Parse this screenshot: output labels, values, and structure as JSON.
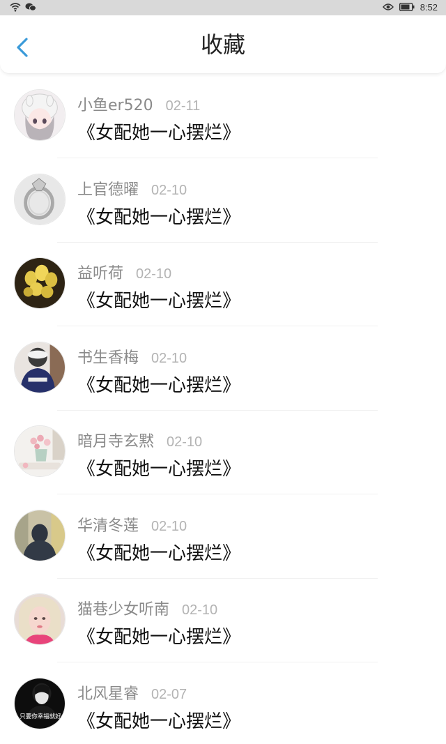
{
  "status_bar": {
    "time": "8:52",
    "icons": [
      "wifi-icon",
      "wechat-icon",
      "eye-icon",
      "battery-icon"
    ]
  },
  "header": {
    "title": "收藏",
    "back_icon": "chevron-left-icon",
    "accent_color": "#3a9ad9"
  },
  "favorites": [
    {
      "username": "小鱼er520",
      "date": "02-11",
      "book": "《女配她一心摆烂》"
    },
    {
      "username": "上官德曜",
      "date": "02-10",
      "book": "《女配她一心摆烂》"
    },
    {
      "username": "益听荷",
      "date": "02-10",
      "book": "《女配她一心摆烂》"
    },
    {
      "username": "书生香梅",
      "date": "02-10",
      "book": "《女配她一心摆烂》"
    },
    {
      "username": "暗月寺玄黙",
      "date": "02-10",
      "book": "《女配她一心摆烂》"
    },
    {
      "username": "华清冬莲",
      "date": "02-10",
      "book": "《女配她一心摆烂》"
    },
    {
      "username": "猫巷少女听南",
      "date": "02-10",
      "book": "《女配她一心摆烂》"
    },
    {
      "username": "北风星睿",
      "date": "02-07",
      "book": "《女配她一心摆烂》"
    }
  ],
  "avatar_overlay_text": "只要你幸福就好"
}
